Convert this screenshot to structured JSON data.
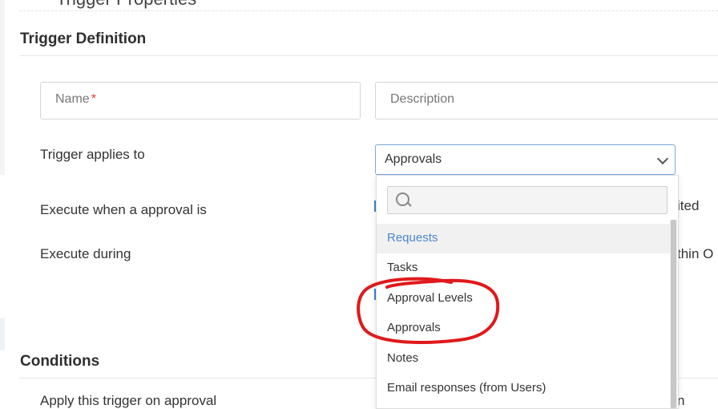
{
  "page": {
    "top_partial_title": "Trigger Properties"
  },
  "trigger_definition": {
    "title": "Trigger Definition",
    "name_placeholder": "Name",
    "name_required": "*",
    "description_placeholder": "Description",
    "applies_to_label": "Trigger applies to",
    "applies_to_value": "Approvals",
    "execute_when_label": "Execute when a approval is",
    "execute_when_right_text": "ited",
    "execute_during_label": "Execute during",
    "execute_during_right_text": "thin O"
  },
  "dropdown": {
    "search_placeholder": "",
    "options": [
      "Requests",
      "Tasks",
      "Approval Levels",
      "Approvals",
      "Notes",
      "Email responses (from Users)"
    ],
    "highlighted_index": 0
  },
  "conditions": {
    "title": "Conditions",
    "apply_label": "Apply this trigger on approval",
    "apply_right_text": "n"
  },
  "annotation": {
    "color": "#e0191b",
    "shape": "hand-drawn-circle"
  },
  "colors": {
    "accent": "#4a86cf",
    "select_border": "#7aa7e0"
  }
}
